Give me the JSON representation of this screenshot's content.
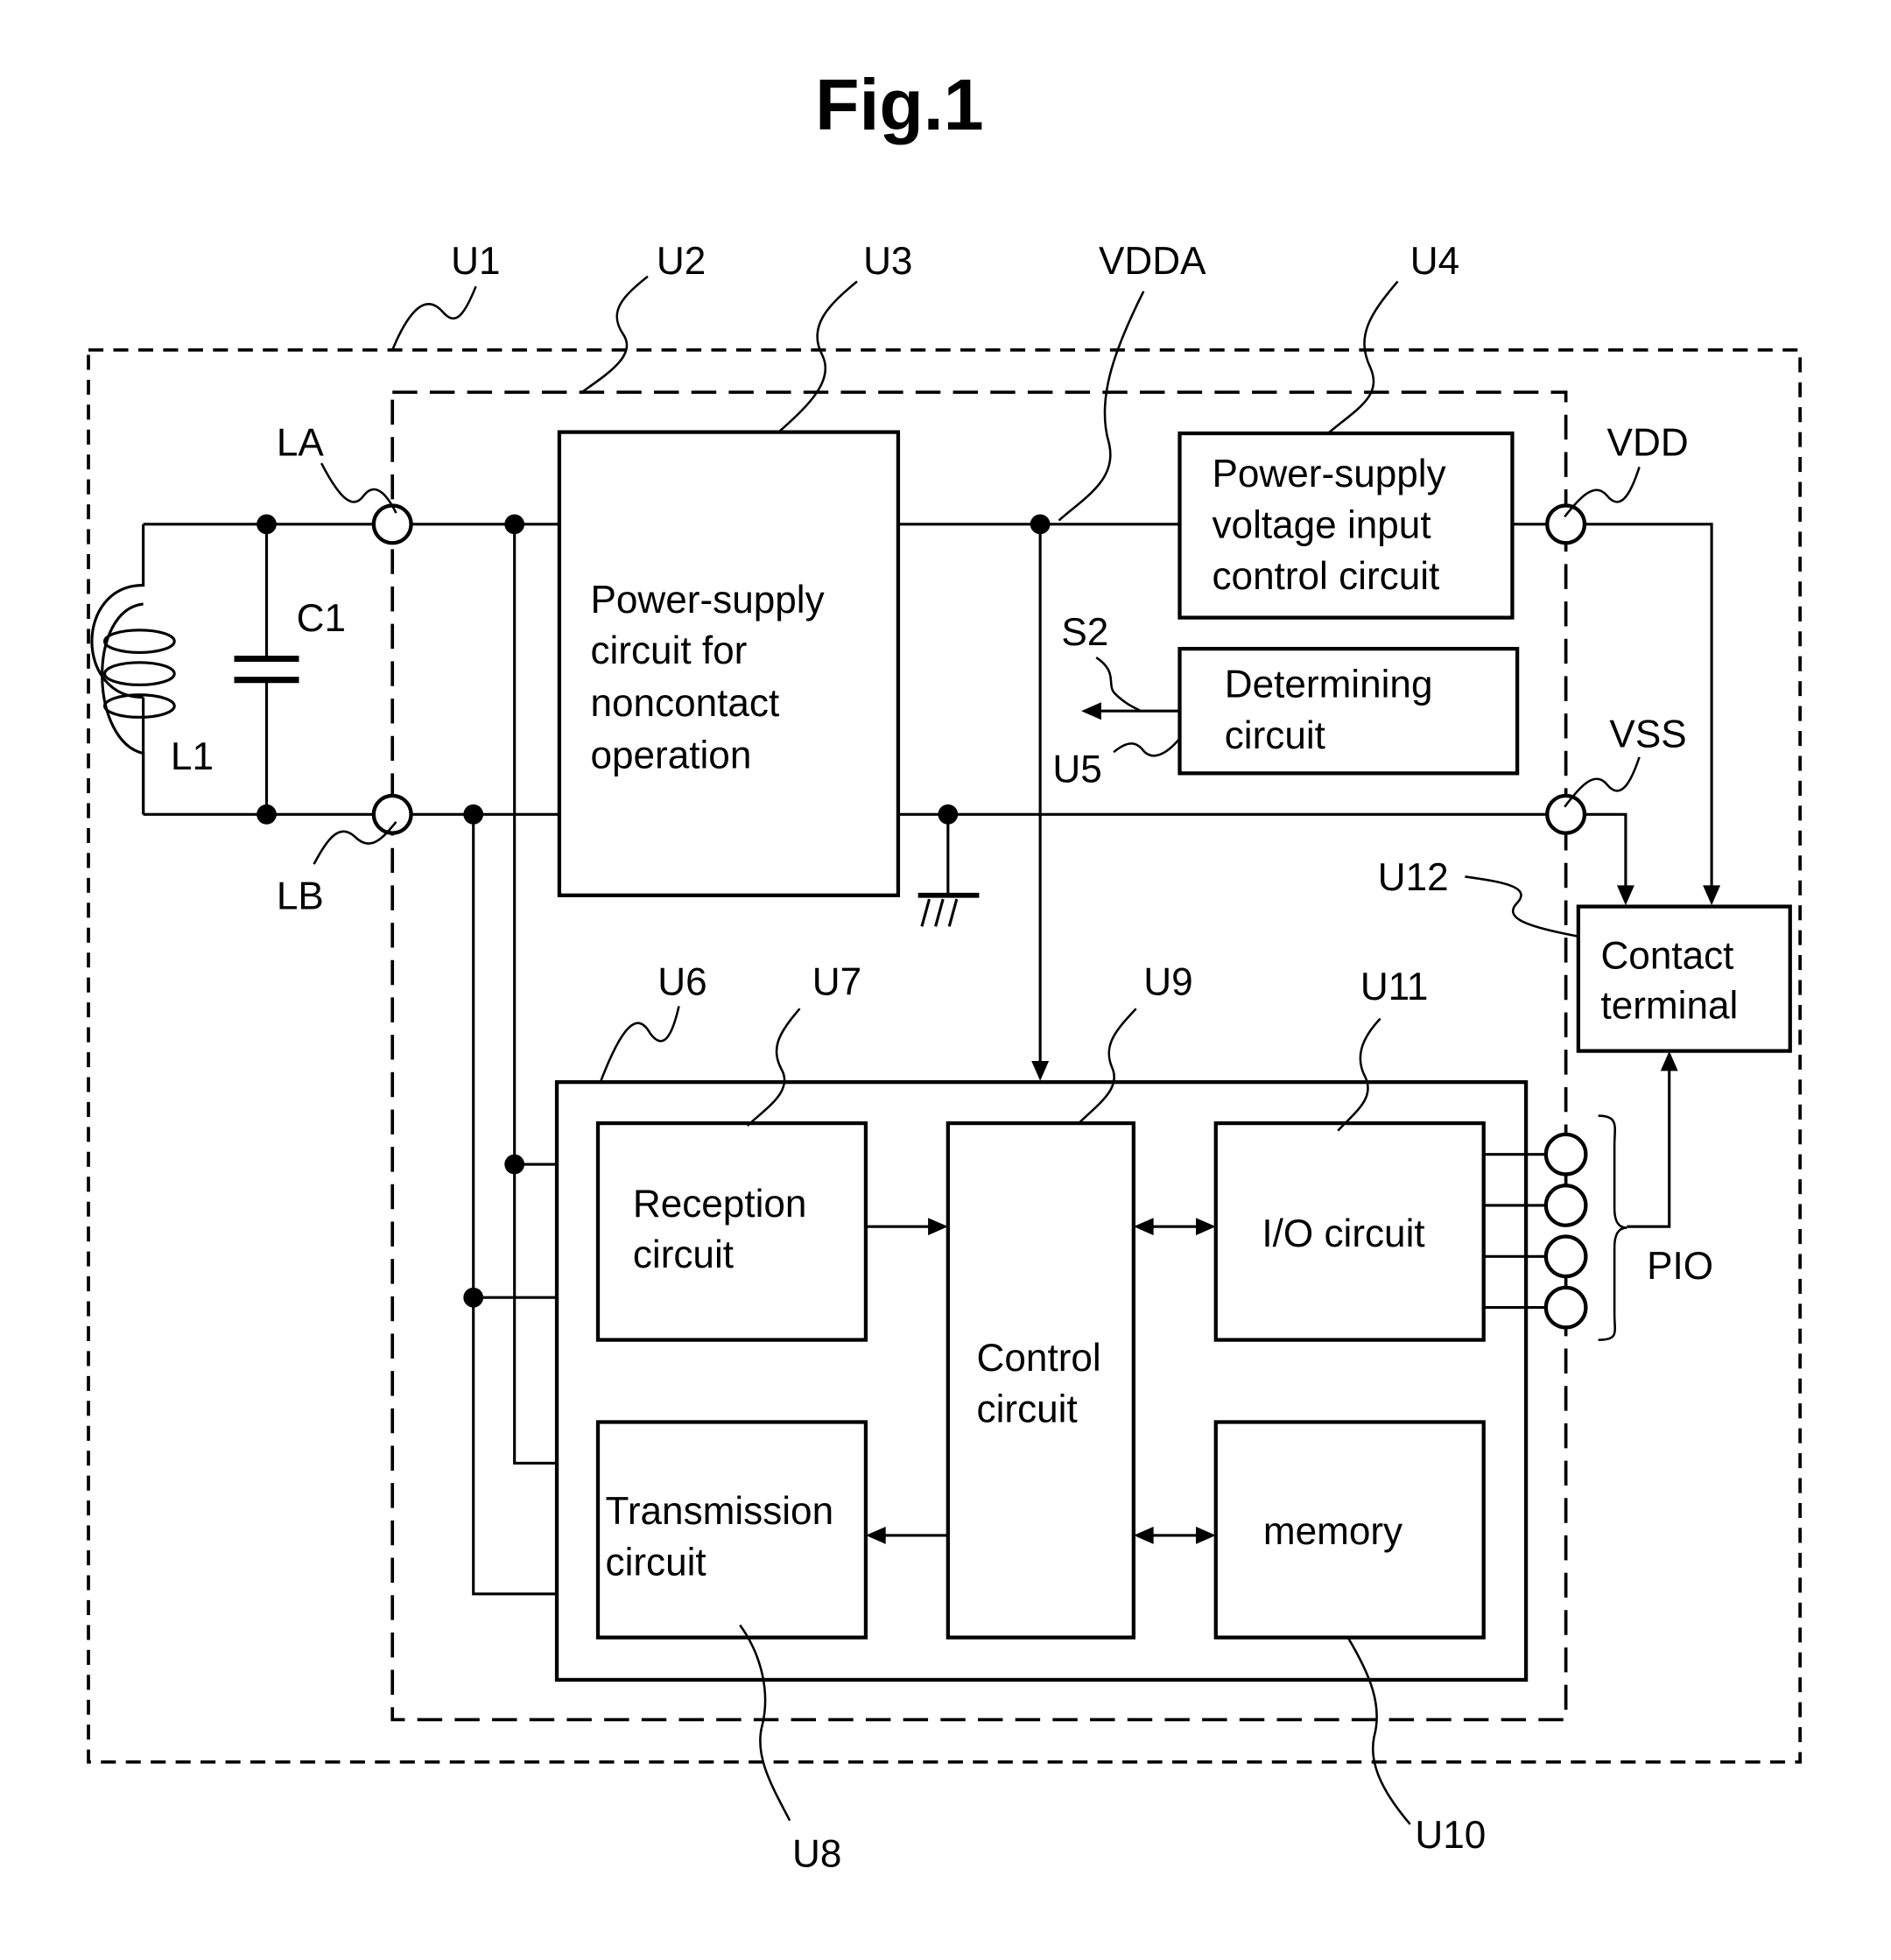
{
  "figure": {
    "title": "Fig.1",
    "reference_labels": {
      "U1": "U1",
      "U2": "U2",
      "U3": "U3",
      "U4": "U4",
      "U5": "U5",
      "U6": "U6",
      "U7": "U7",
      "U8": "U8",
      "U9": "U9",
      "U10": "U10",
      "U11": "U11",
      "U12": "U12",
      "VDDA": "VDDA",
      "VDD": "VDD",
      "VSS": "VSS",
      "LA": "LA",
      "LB": "LB",
      "C1": "C1",
      "L1": "L1",
      "S2": "S2",
      "PIO": "PIO"
    },
    "blocks": {
      "power_supply_noncontact": [
        "Power-supply",
        "circuit for",
        "noncontact",
        "operation"
      ],
      "voltage_input_control": [
        "Power-supply",
        "voltage input",
        "control circuit"
      ],
      "determining": [
        "Determining",
        "circuit"
      ],
      "contact_terminal": [
        "Contact",
        "terminal"
      ],
      "reception": [
        "Reception",
        "circuit"
      ],
      "transmission": [
        "Transmission",
        "circuit"
      ],
      "control": [
        "Control",
        "circuit"
      ],
      "io": [
        "I/O circuit"
      ],
      "memory": [
        "memory"
      ]
    }
  }
}
